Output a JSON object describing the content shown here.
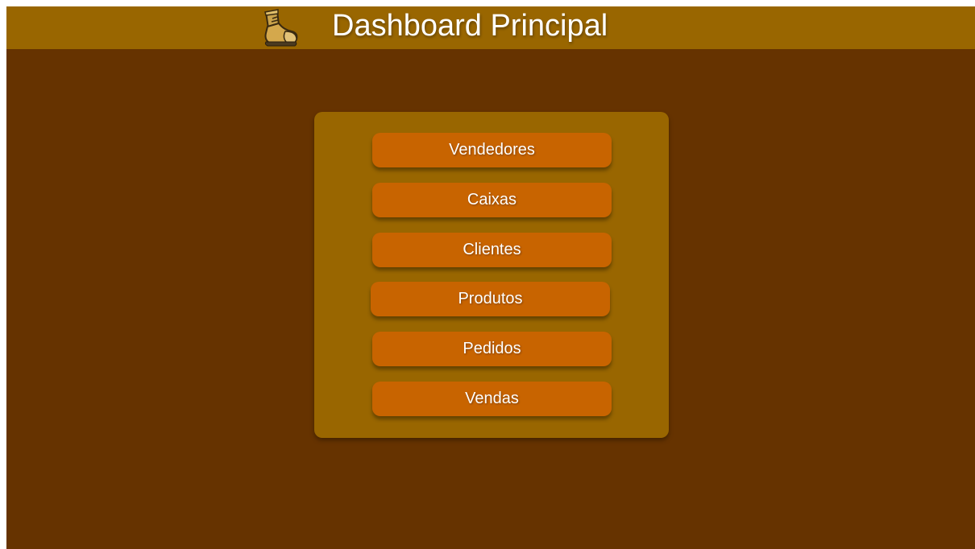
{
  "header": {
    "title": "Dashboard Principal",
    "logo_icon": "boot-icon",
    "background_color": "#996600"
  },
  "page": {
    "background_color": "#663300"
  },
  "menu": {
    "panel_color": "#996600",
    "button_color": "#c86400",
    "buttons": [
      {
        "label": "Vendedores"
      },
      {
        "label": "Caixas"
      },
      {
        "label": "Clientes"
      },
      {
        "label": "Produtos"
      },
      {
        "label": "Pedidos"
      },
      {
        "label": "Vendas"
      }
    ]
  }
}
